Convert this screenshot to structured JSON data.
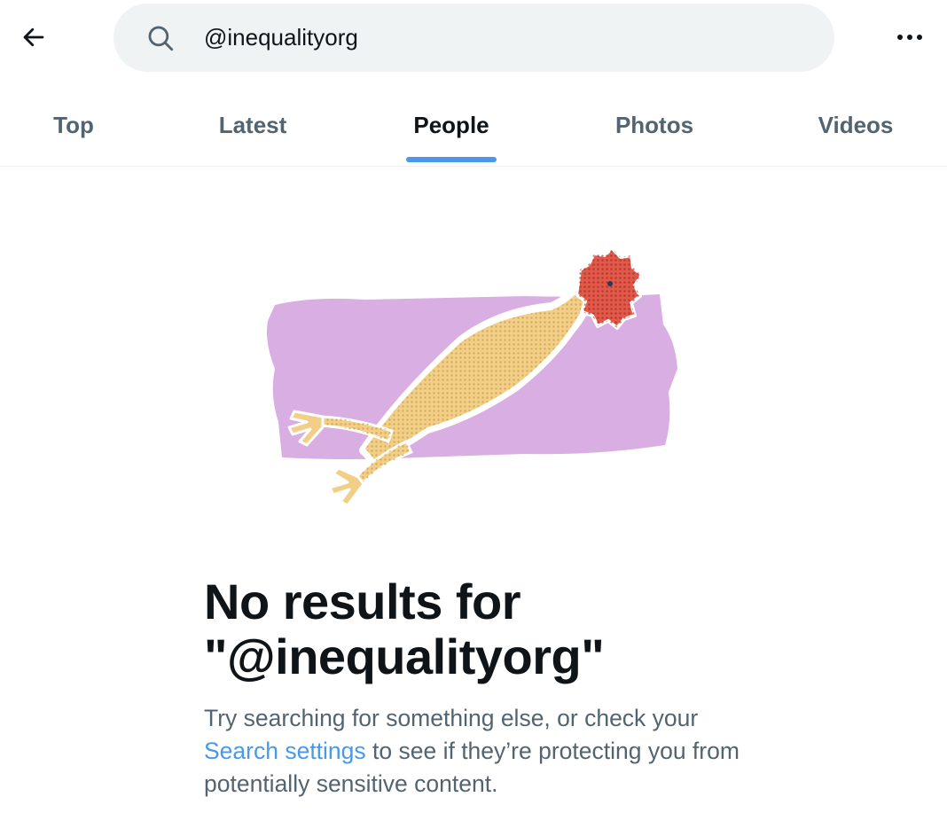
{
  "header": {
    "search": {
      "value": "@inequalityorg",
      "icon": "search-icon"
    },
    "back_icon": "arrow-left-icon",
    "more_icon": "ellipsis-icon"
  },
  "tabs": [
    {
      "label": "Top",
      "active": false
    },
    {
      "label": "Latest",
      "active": false
    },
    {
      "label": "People",
      "active": true
    },
    {
      "label": "Photos",
      "active": false
    },
    {
      "label": "Videos",
      "active": false
    }
  ],
  "empty_state": {
    "title_line1": "No results for",
    "title_line2": "\"@inequalityorg\"",
    "body_before": "Try searching for something else, or check your",
    "link": "Search settings",
    "body_after": "to see if they’re protecting you from potentially sensitive content.",
    "illustration": "rubber-chicken-illustration"
  },
  "colors": {
    "accent": "#4a99e9",
    "text_primary": "#0f1419",
    "text_secondary": "#536471",
    "search_bg": "#eff3f4",
    "illustration_bg": "#d8aee3"
  }
}
